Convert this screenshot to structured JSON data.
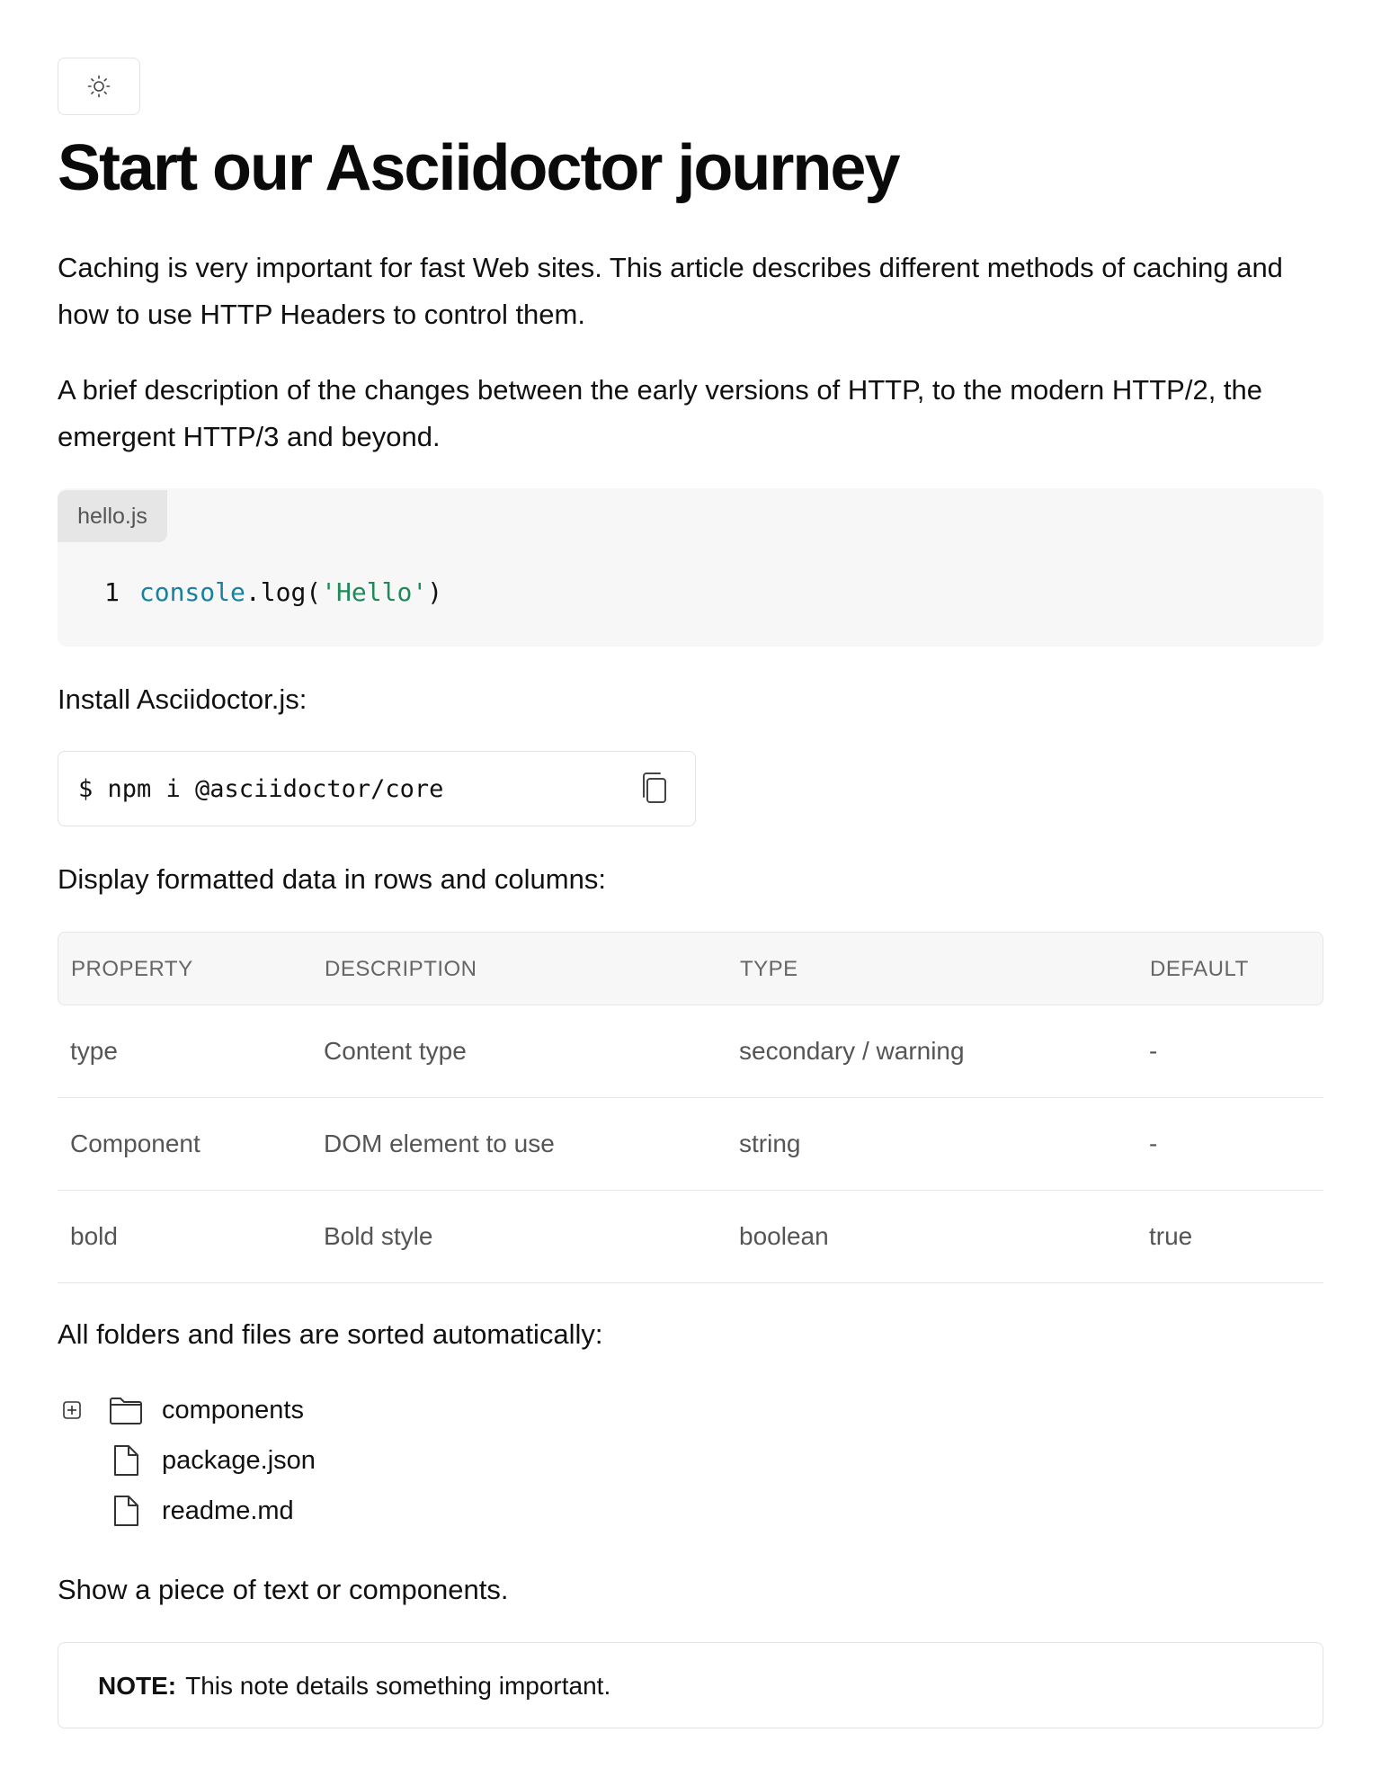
{
  "header": {
    "theme_toggle_icon": "sun-icon",
    "title": "Start our Asciidoctor journey"
  },
  "content": {
    "paragraph_1": "Caching is very important for fast Web sites. This article describes different methods of caching and how to use HTTP Headers to control them.",
    "paragraph_2": "A brief description of the changes between the early versions of HTTP, to the modern HTTP/2, the emergent HTTP/3 and beyond.",
    "code_block": {
      "filename": "hello.js",
      "line_number": "1",
      "code_object": "console",
      "code_method": ".log(",
      "code_string": "'Hello'",
      "code_close": ")"
    },
    "install_label": "Install Asciidoctor.js:",
    "command": {
      "text": "$ npm i @asciidoctor/core",
      "copy_icon": "copy-icon"
    },
    "table_label": "Display formatted data in rows and columns:",
    "table": {
      "headers": [
        "PROPERTY",
        "DESCRIPTION",
        "TYPE",
        "DEFAULT"
      ],
      "rows": [
        [
          "type",
          "Content type",
          "secondary / warning",
          "-"
        ],
        [
          "Component",
          "DOM element to use",
          "string",
          "-"
        ],
        [
          "bold",
          "Bold style",
          "boolean",
          "true"
        ]
      ]
    },
    "files_label": "All folders and files are sorted automatically:",
    "file_tree": [
      {
        "name": "components",
        "icon": "folder-icon",
        "expandable": true
      },
      {
        "name": "package.json",
        "icon": "file-icon",
        "expandable": false
      },
      {
        "name": "readme.md",
        "icon": "file-icon",
        "expandable": false
      }
    ],
    "show_label": "Show a piece of text or components.",
    "note": {
      "label": "NOTE:",
      "text": "This note details something important."
    }
  },
  "colors": {
    "code_object": "#1b7fa0",
    "code_string": "#1e8a5a",
    "code_bg": "#f7f7f7",
    "border": "#e3e3e3"
  }
}
